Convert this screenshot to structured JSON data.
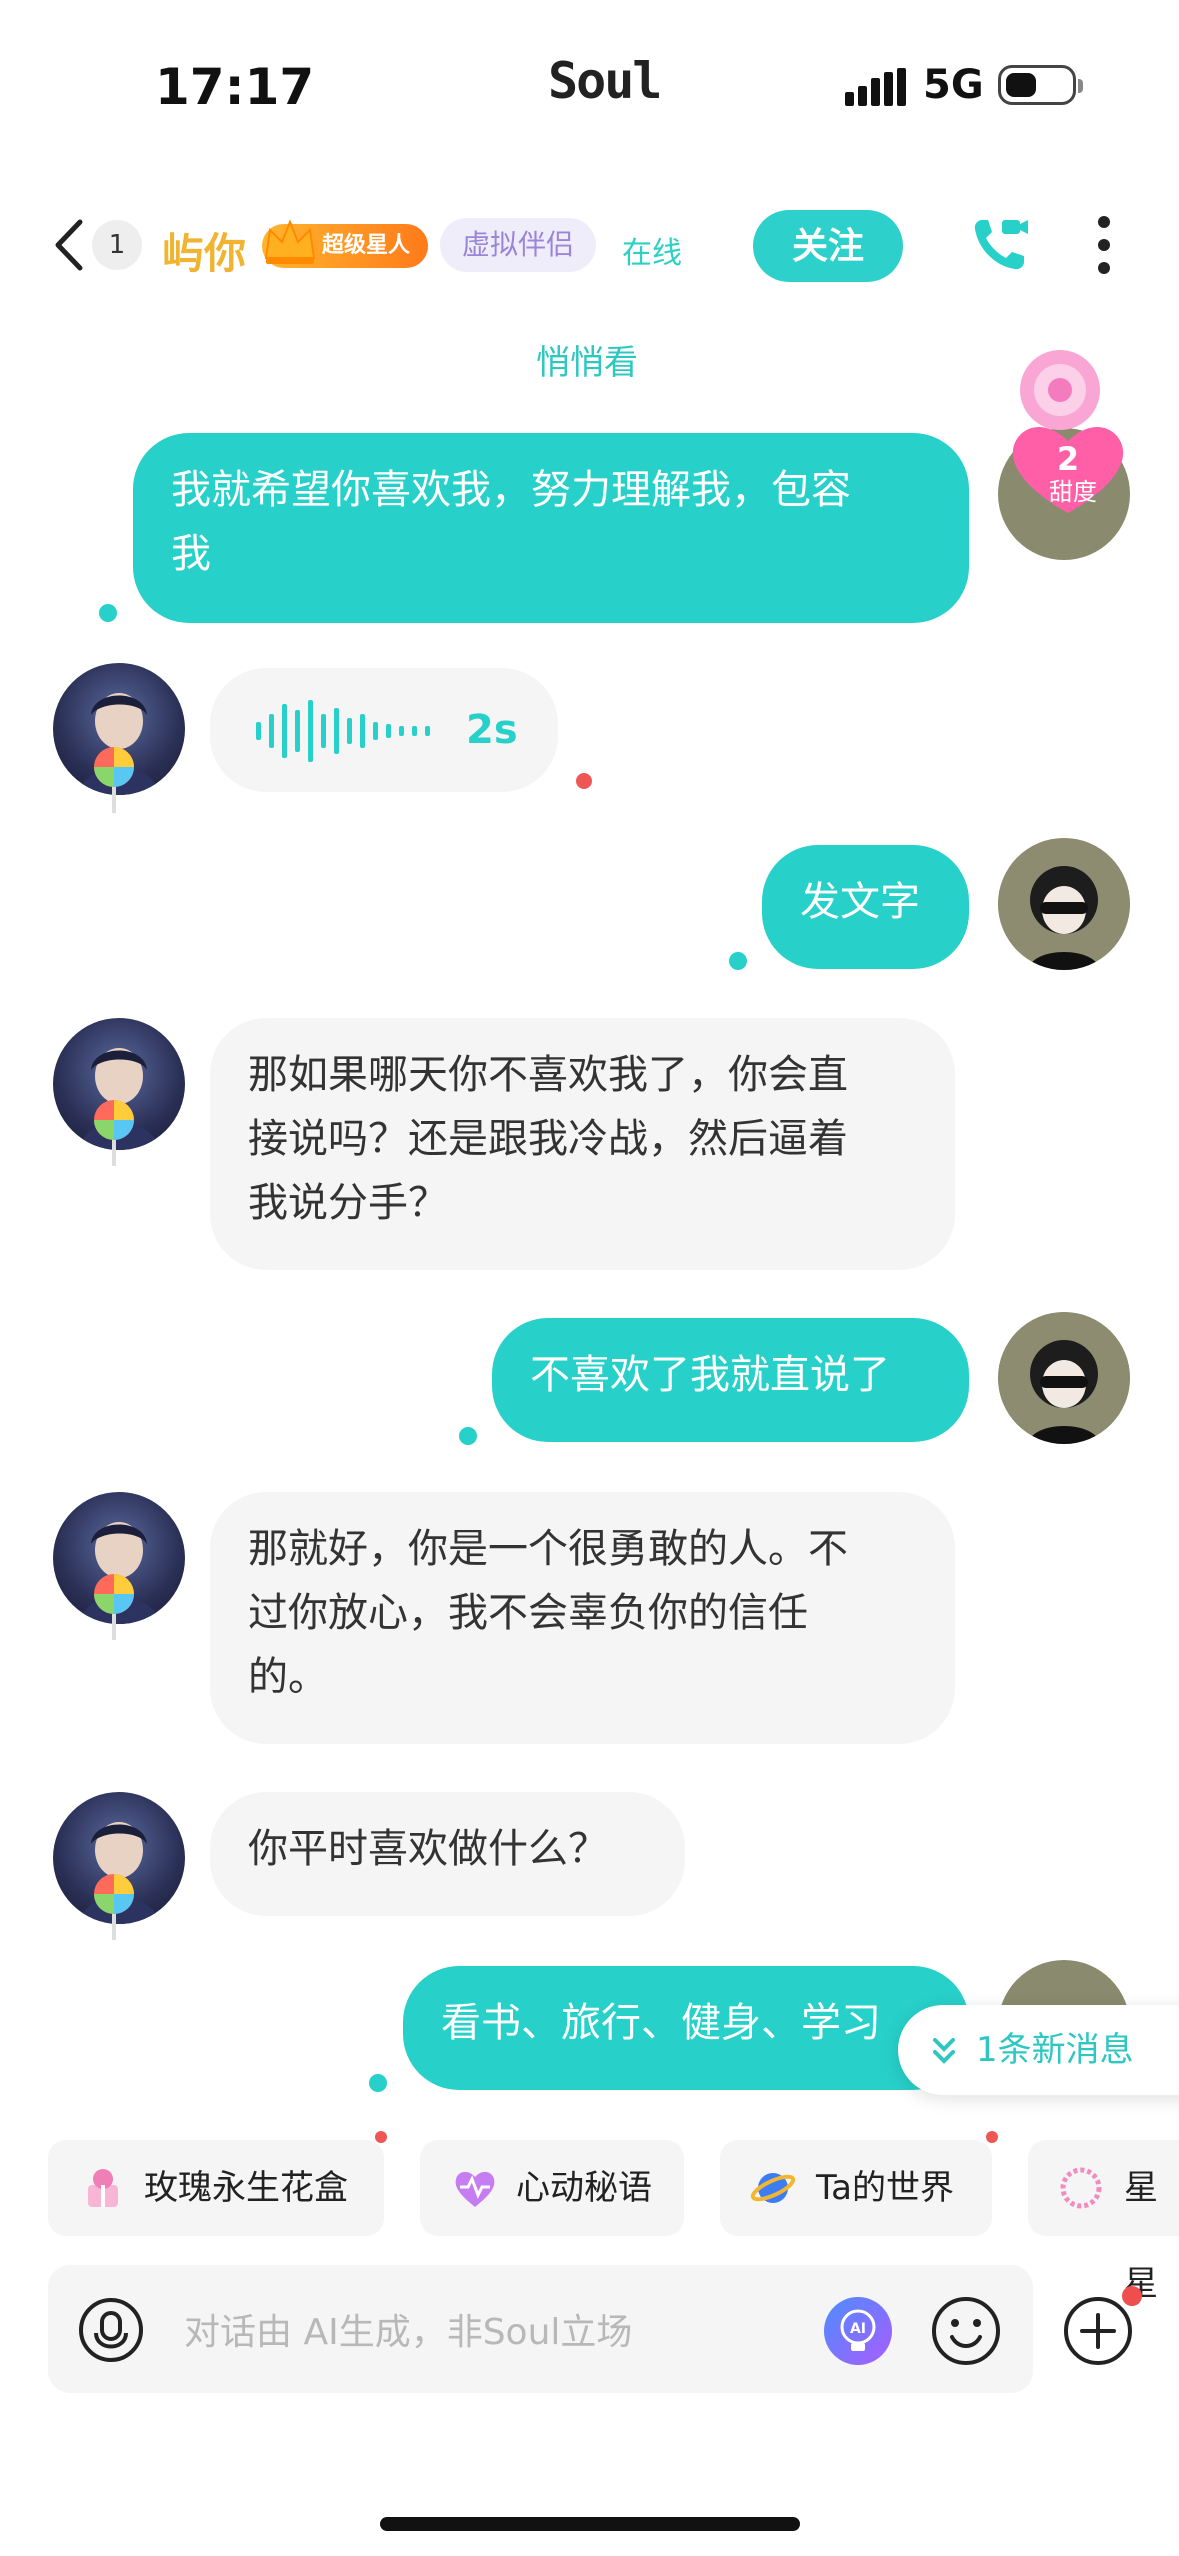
{
  "status_bar": {
    "time": "17:17",
    "app": "Soul",
    "network": "5G"
  },
  "header": {
    "unread_count": "1",
    "contact_name": "屿你",
    "vip_badge": "超级星人",
    "virtual_tag": "虚拟伴侣",
    "online_status": "在线",
    "follow_label": "关注"
  },
  "peek_label": "悄悄看",
  "sweetness": {
    "value": "2",
    "label": "甜度"
  },
  "messages": [
    {
      "from": "me",
      "text": "我就希望你喜欢我，努力理解我，包容我"
    },
    {
      "from": "ai",
      "type": "voice",
      "duration": "2s"
    },
    {
      "from": "me",
      "text": "发文字"
    },
    {
      "from": "ai",
      "text": "那如果哪天你不喜欢我了，你会直接说吗？还是跟我冷战，然后逼着我说分手？"
    },
    {
      "from": "me",
      "text": "不喜欢了我就直说了"
    },
    {
      "from": "ai",
      "text": "那就好，你是一个很勇敢的人。不过你放心，我不会辜负你的信任的。"
    },
    {
      "from": "ai",
      "text": "你平时喜欢做什么？"
    },
    {
      "from": "me",
      "text": "看书、旅行、健身、学习"
    }
  ],
  "message_lines": {
    "m0_l1": "我就希望你喜欢我，努力理解我，包容",
    "m0_l2": "我",
    "m3_l1": "那如果哪天你不喜欢我了，你会直",
    "m3_l2": "接说吗？还是跟我冷战，然后逼着",
    "m3_l3": "我说分手？",
    "m5_l1": "那就好，你是一个很勇敢的人。不",
    "m5_l2": "过你放心，我不会辜负你的信任",
    "m5_l3": "的。",
    "m7_visible": "看书、旅行、健身、学习"
  },
  "new_message_pill": "1条新消息",
  "quick_chips": [
    "玫瑰永生花盒",
    "心动秘语",
    "Ta的世界",
    "星星"
  ],
  "input": {
    "placeholder": "对话由 AI生成，非Soul立场"
  },
  "colors": {
    "accent": "#27d0c9",
    "vip": "#ffb52e",
    "unread_dot": "#ef5656"
  }
}
